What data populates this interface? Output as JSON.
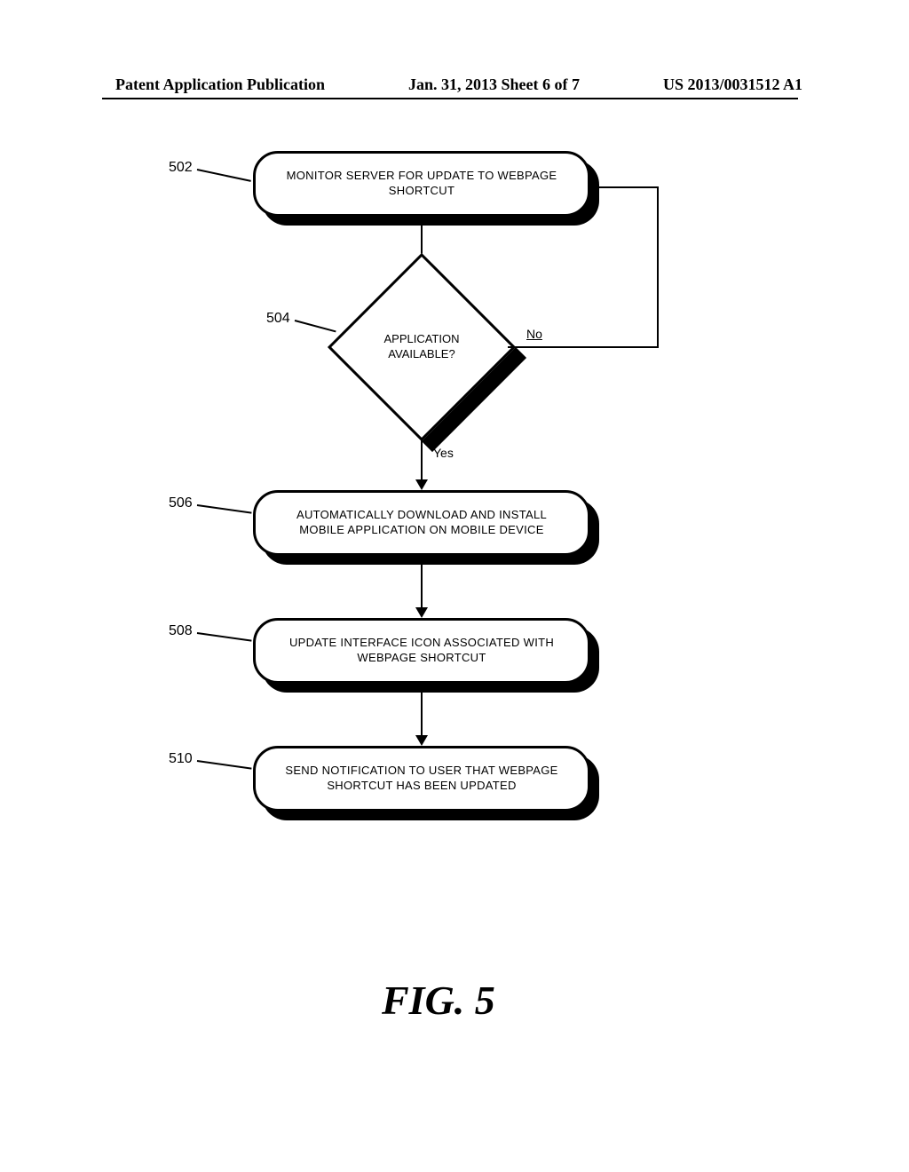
{
  "header": {
    "left": "Patent Application Publication",
    "center": "Jan. 31, 2013  Sheet 6 of 7",
    "right": "US 2013/0031512 A1"
  },
  "refs": {
    "r502": "502",
    "r504": "504",
    "r506": "506",
    "r508": "508",
    "r510": "510"
  },
  "steps": {
    "s502": "MONITOR SERVER FOR UPDATE TO WEBPAGE SHORTCUT",
    "s504": "APPLICATION AVAILABLE?",
    "s506": "AUTOMATICALLY DOWNLOAD AND INSTALL MOBILE APPLICATION ON MOBILE DEVICE",
    "s508": "UPDATE INTERFACE ICON ASSOCIATED WITH WEBPAGE SHORTCUT",
    "s510": "SEND NOTIFICATION TO USER THAT WEBPAGE SHORTCUT HAS BEEN UPDATED"
  },
  "branches": {
    "no": "No",
    "yes": "Yes"
  },
  "figure": "FIG. 5",
  "chart_data": {
    "type": "flowchart",
    "nodes": [
      {
        "id": "502",
        "kind": "process",
        "text": "MONITOR SERVER FOR UPDATE TO WEBPAGE SHORTCUT"
      },
      {
        "id": "504",
        "kind": "decision",
        "text": "APPLICATION AVAILABLE?"
      },
      {
        "id": "506",
        "kind": "process",
        "text": "AUTOMATICALLY DOWNLOAD AND INSTALL MOBILE APPLICATION ON MOBILE DEVICE"
      },
      {
        "id": "508",
        "kind": "process",
        "text": "UPDATE INTERFACE ICON ASSOCIATED WITH WEBPAGE SHORTCUT"
      },
      {
        "id": "510",
        "kind": "process",
        "text": "SEND NOTIFICATION TO USER THAT WEBPAGE SHORTCUT HAS BEEN UPDATED"
      }
    ],
    "edges": [
      {
        "from": "502",
        "to": "504",
        "label": ""
      },
      {
        "from": "504",
        "to": "502",
        "label": "No"
      },
      {
        "from": "504",
        "to": "506",
        "label": "Yes"
      },
      {
        "from": "506",
        "to": "508",
        "label": ""
      },
      {
        "from": "508",
        "to": "510",
        "label": ""
      }
    ],
    "figure_label": "FIG. 5"
  }
}
